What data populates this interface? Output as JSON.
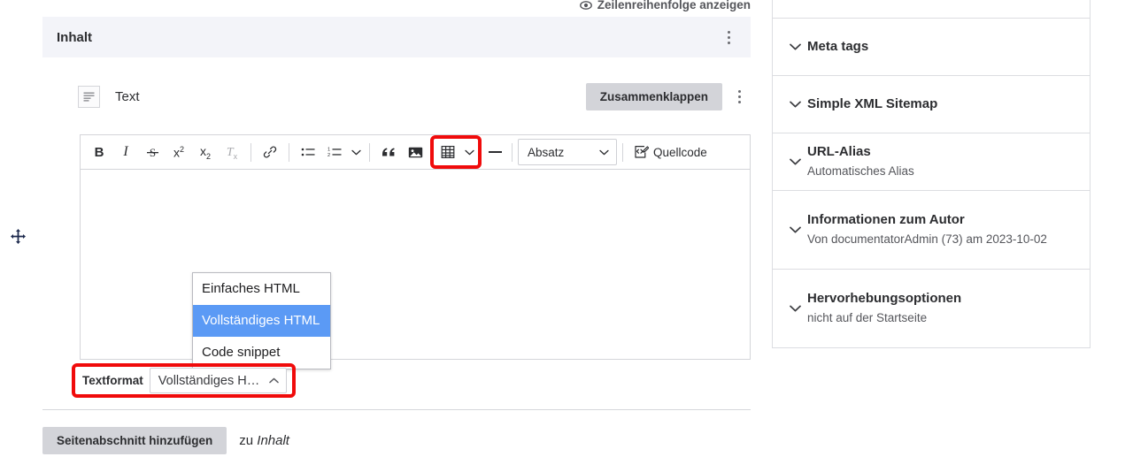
{
  "main": {
    "row_order_link": "Zeilenreihenfolge anzeigen",
    "section_title": "Inhalt",
    "paragraph_label": "Text",
    "collapse_button": "Zusammenklappen",
    "toolbar": {
      "bold": "B",
      "italic": "I",
      "strikethrough": "S",
      "superscript_base": "x",
      "superscript_exp": "2",
      "subscript_base": "x",
      "subscript_exp": "2",
      "remove_format_base": "T",
      "remove_format_sub": "x",
      "paragraph_style": "Absatz",
      "source_label": "Quellcode"
    },
    "text_format": {
      "label": "Textformat",
      "selected_value": "Vollständiges H…",
      "options": [
        "Einfaches HTML",
        "Vollständiges HTML",
        "Code snippet"
      ],
      "selected_index": 1
    },
    "add_section_button": "Seitenabschnitt hinzufügen",
    "add_section_suffix": "zu",
    "add_section_target": "Inhalt"
  },
  "sidebar": {
    "items": [
      {
        "title": "Meta tags",
        "sub": ""
      },
      {
        "title": "Simple XML Sitemap",
        "sub": ""
      },
      {
        "title": "URL-Alias",
        "sub": "Automatisches Alias"
      },
      {
        "title": "Informationen zum Autor",
        "sub": "Von documentatorAdmin (73) am 2023-10-02"
      },
      {
        "title": "Hervorhebungsoptionen",
        "sub": "nicht auf der Startseite"
      }
    ]
  },
  "colors": {
    "highlight": "#f00b0b",
    "selected_option_bg": "#5b9af5",
    "section_header_bg": "#f3f4f9",
    "button_bg": "#d3d4d9"
  }
}
